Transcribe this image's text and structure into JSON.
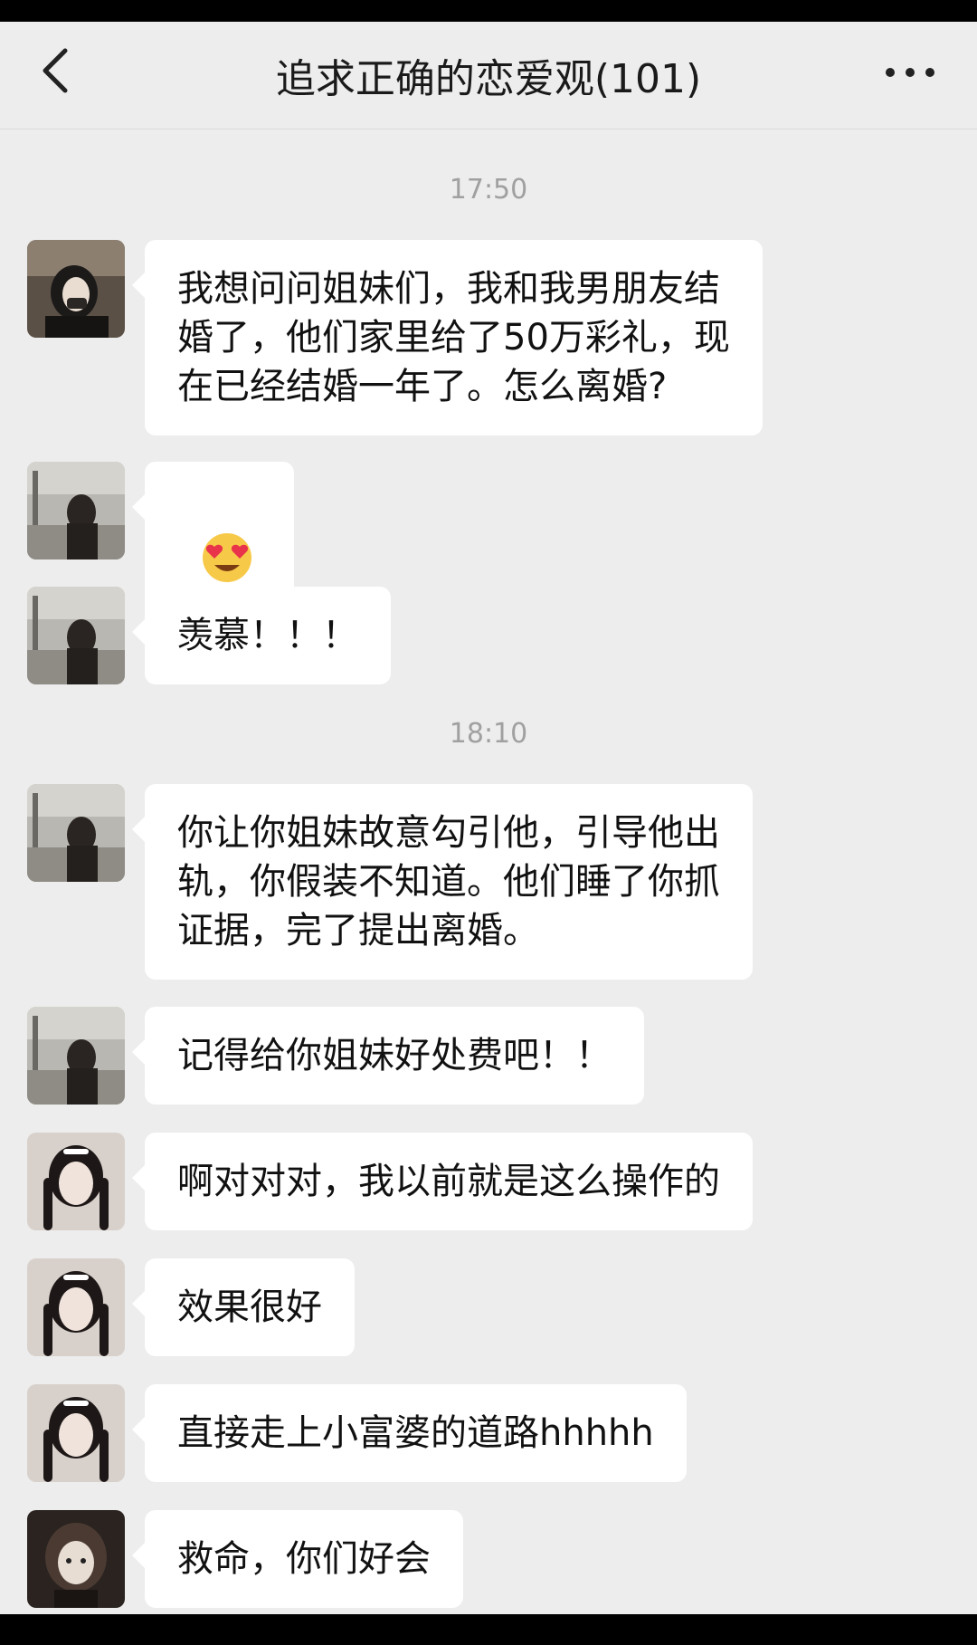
{
  "header": {
    "title": "追求正确的恋爱观(101)",
    "back_icon": "chevron-left-icon",
    "more_icon": "ellipsis-icon"
  },
  "timestamps": [
    "17:50",
    "18:10"
  ],
  "messages": [
    {
      "sender_avatar": "avatar-girl-dark",
      "text": "我想问问姐妹们，我和我男朋友结\n婚了，他们家里给了50万彩礼，现\n在已经结婚一年了。怎么离婚?"
    },
    {
      "sender_avatar": "avatar-girl-street",
      "emoji": [
        "heart-eyes-emoji",
        "heart-eyes-emoji"
      ]
    },
    {
      "sender_avatar": "avatar-girl-street",
      "text": "羡慕！！！"
    },
    {
      "sender_avatar": "avatar-girl-street",
      "text": "你让你姐妹故意勾引他，引导他出\n轨，你假装不知道。他们睡了你抓\n证据，完了提出离婚。"
    },
    {
      "sender_avatar": "avatar-girl-street",
      "text": "记得给你姐妹好处费吧！！"
    },
    {
      "sender_avatar": "avatar-girl-braids",
      "text": "啊对对对，我以前就是这么操作的"
    },
    {
      "sender_avatar": "avatar-girl-braids",
      "text": "效果很好"
    },
    {
      "sender_avatar": "avatar-girl-braids",
      "text": "直接走上小富婆的道路hhhhh"
    },
    {
      "sender_avatar": "avatar-anime",
      "text": "救命，你们好会"
    }
  ],
  "colors": {
    "background": "#ededed",
    "bubble": "#ffffff",
    "timestamp": "#a0a0a0"
  }
}
